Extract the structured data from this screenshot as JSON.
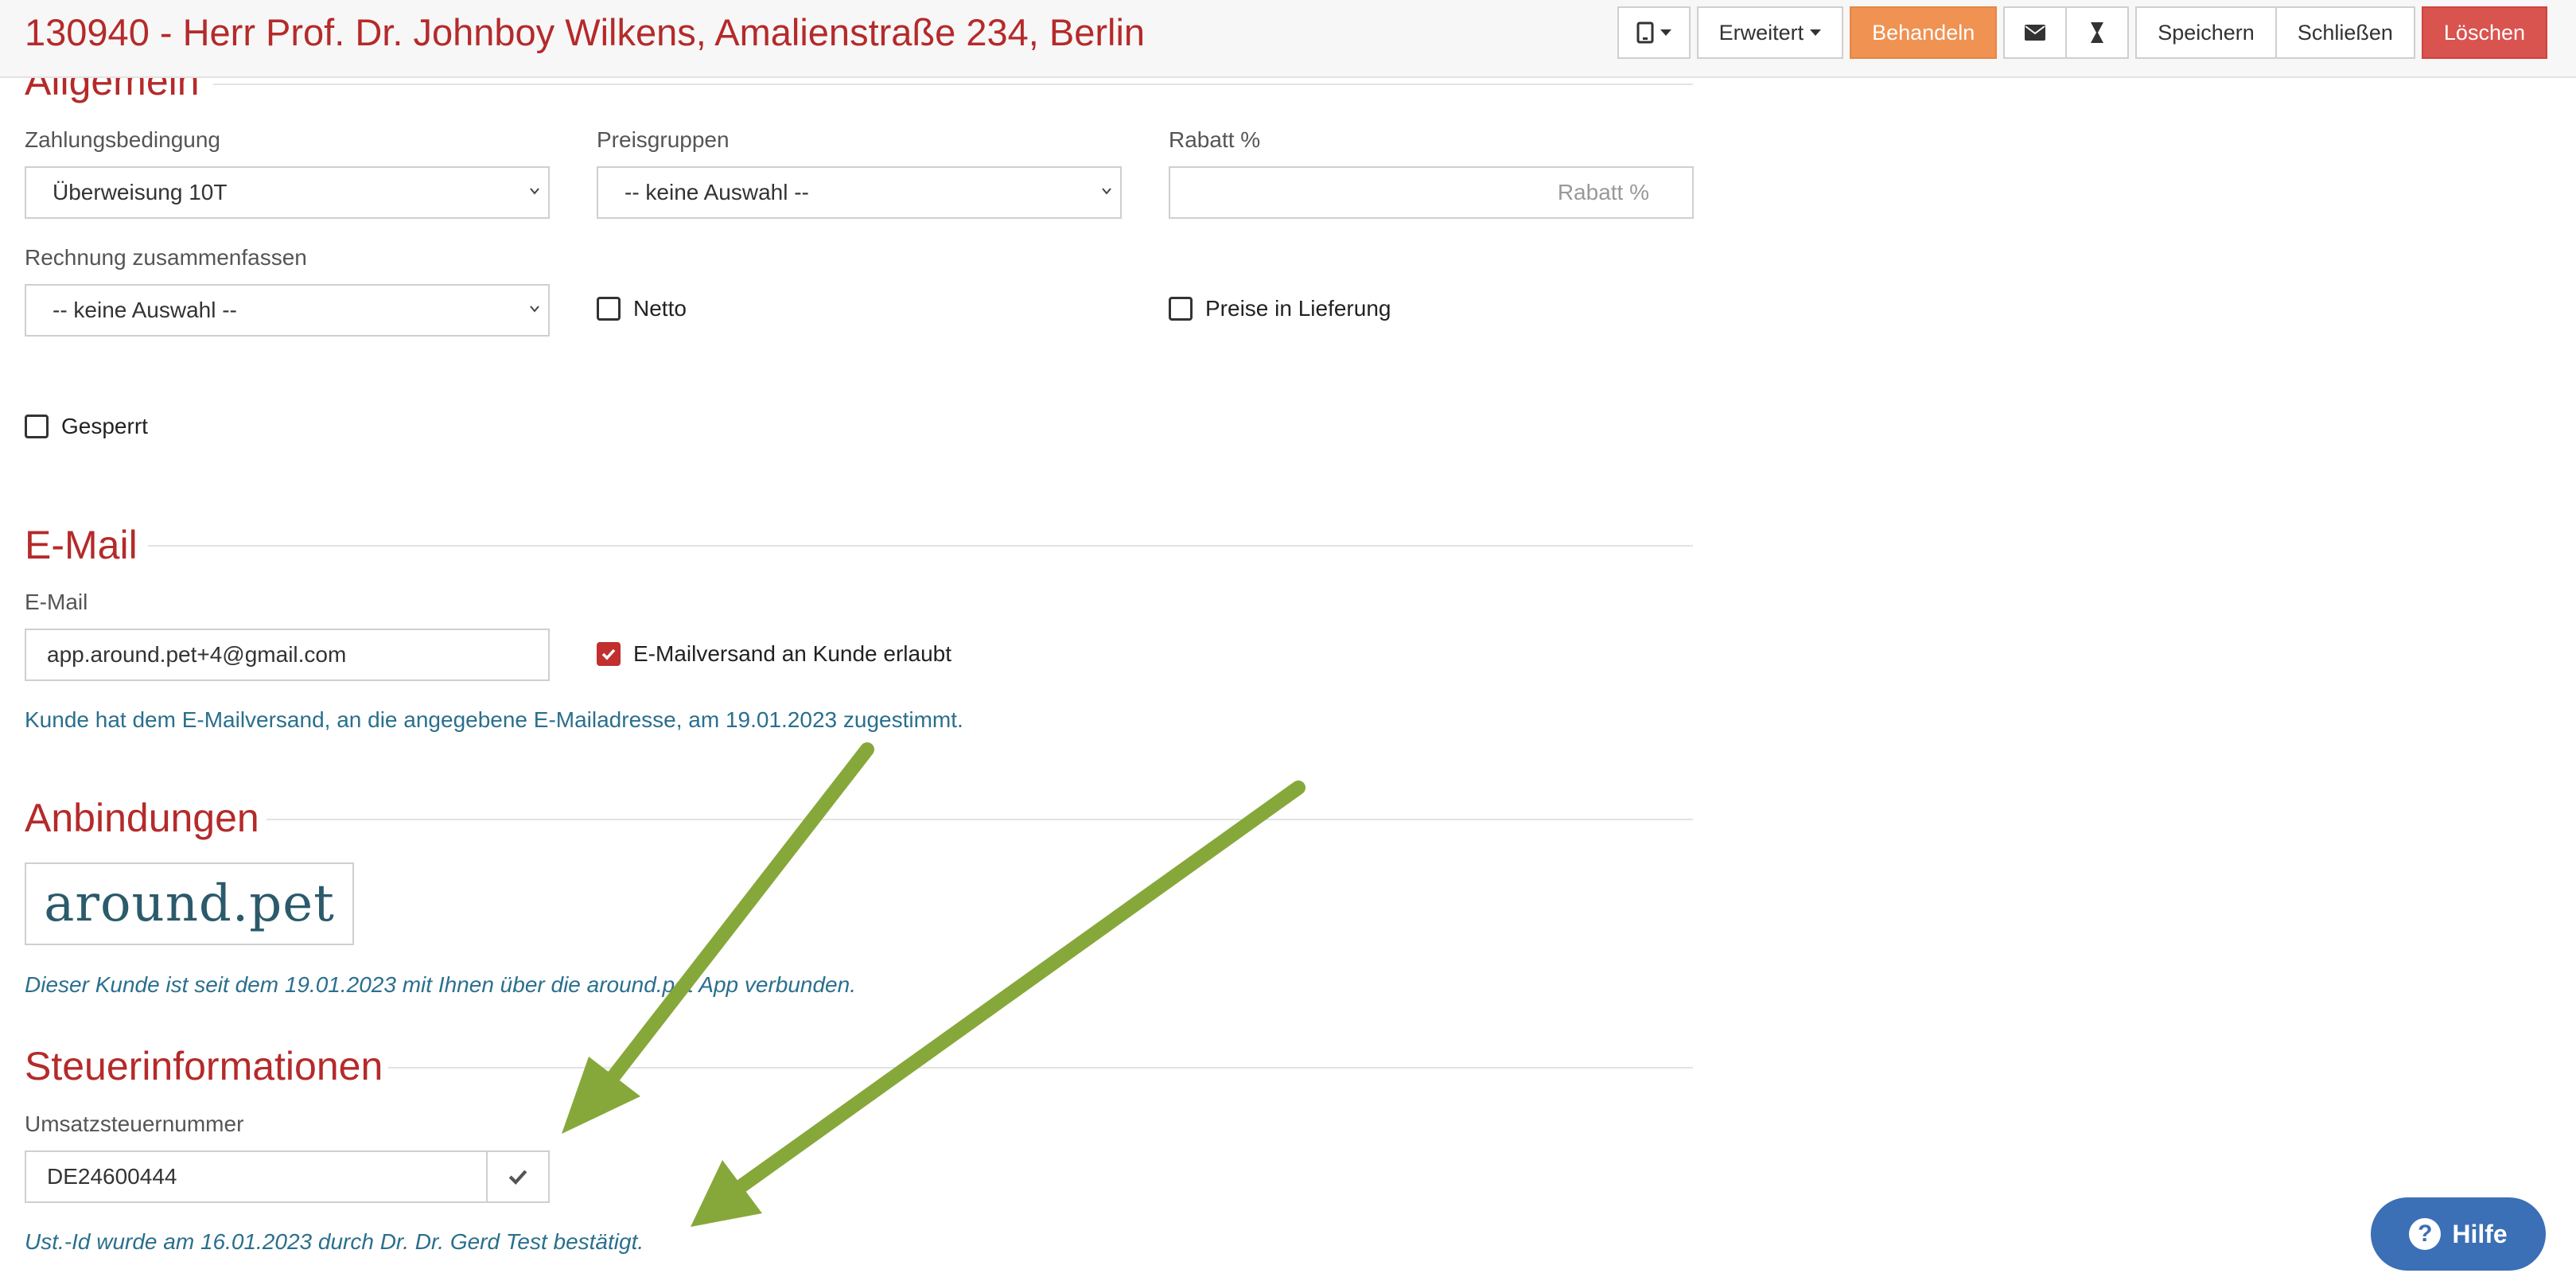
{
  "header": {
    "title": "130940 - Herr Prof. Dr. Johnboy Wilkens, Amalienstraße 234, Berlin",
    "buttons": {
      "extended": "Erweitert",
      "treat": "Behandeln",
      "save": "Speichern",
      "close": "Schließen",
      "delete": "Löschen"
    }
  },
  "sections": {
    "general": {
      "title": "Allgemein",
      "payment_terms_label": "Zahlungsbedingung",
      "payment_terms_value": "Überweisung 10T",
      "price_groups_label": "Preisgruppen",
      "price_groups_value": "-- keine Auswahl --",
      "discount_label": "Rabatt %",
      "discount_placeholder": "Rabatt %",
      "combine_invoice_label": "Rechnung zusammenfassen",
      "combine_invoice_value": "-- keine Auswahl --",
      "netto_label": "Netto",
      "prices_in_delivery_label": "Preise in Lieferung",
      "blocked_label": "Gesperrt"
    },
    "email": {
      "title": "E-Mail",
      "email_label": "E-Mail",
      "email_value": "app.around.pet+4@gmail.com",
      "email_allowed_label": "E-Mailversand an Kunde erlaubt",
      "consent_text": "Kunde hat dem E-Mailversand, an die angegebene E-Mailadresse, am 19.01.2023 zugestimmt."
    },
    "connections": {
      "title": "Anbindungen",
      "logo_text": "around.pet",
      "info_text": "Dieser Kunde ist seit dem 19.01.2023 mit Ihnen über die around.pet App verbunden."
    },
    "tax": {
      "title": "Steuerinformationen",
      "vat_label": "Umsatzsteuernummer",
      "vat_value": "DE24600444",
      "confirmation_text": "Ust.-Id wurde am 16.01.2023 durch Dr. Dr. Gerd Test bestätigt."
    }
  },
  "help": {
    "label": "Hilfe"
  },
  "colors": {
    "accent_red": "#b52a2a",
    "behandeln": "#ef9252",
    "delete": "#d9534f",
    "info_blue": "#2a6f8e",
    "arrow_green": "#86a83a",
    "help_blue": "#3b6fb6"
  }
}
